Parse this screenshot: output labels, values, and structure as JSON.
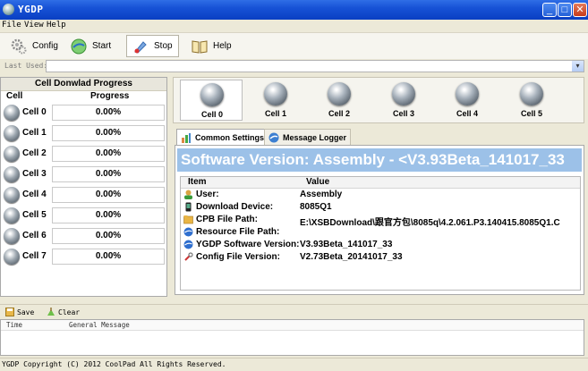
{
  "window": {
    "title": "YGDP"
  },
  "menu": [
    "File",
    "View",
    "Help"
  ],
  "toolbar": {
    "config": "Config",
    "start": "Start",
    "stop": "Stop",
    "help": "Help"
  },
  "last_used": {
    "label": "Last Used:",
    "value": ""
  },
  "progress_panel": {
    "title": "Cell Donwlad Progress",
    "col_cell": "Cell",
    "col_progress": "Progress",
    "rows": [
      {
        "cell": "Cell 0",
        "progress": "0.00%"
      },
      {
        "cell": "Cell 1",
        "progress": "0.00%"
      },
      {
        "cell": "Cell 2",
        "progress": "0.00%"
      },
      {
        "cell": "Cell 3",
        "progress": "0.00%"
      },
      {
        "cell": "Cell 4",
        "progress": "0.00%"
      },
      {
        "cell": "Cell 5",
        "progress": "0.00%"
      },
      {
        "cell": "Cell 6",
        "progress": "0.00%"
      },
      {
        "cell": "Cell 7",
        "progress": "0.00%"
      }
    ]
  },
  "cell_tabs": [
    "Cell 0",
    "Cell 1",
    "Cell 2",
    "Cell 3",
    "Cell 4",
    "Cell 5"
  ],
  "tabs": {
    "common": "Common Settings",
    "logger": "Message Logger"
  },
  "info": {
    "version_banner": "Software Version:  Assembly - <V3.93Beta_141017_33",
    "col_item": "Item",
    "col_value": "Value",
    "rows": [
      {
        "item": "User:",
        "value": "Assembly",
        "icon": "user-icon"
      },
      {
        "item": "Download Device:",
        "value": "8085Q1",
        "icon": "phone-icon"
      },
      {
        "item": "CPB File Path:",
        "value": "E:\\XSBDownload\\跟官方包\\8085q\\4.2.061.P3.140415.8085Q1.C",
        "icon": "folder-icon"
      },
      {
        "item": "Resource File Path:",
        "value": "",
        "icon": "globe-icon"
      },
      {
        "item": "YGDP Software Version:",
        "value": "V3.93Beta_141017_33",
        "icon": "globe-icon"
      },
      {
        "item": "Config File Version:",
        "value": "V2.73Beta_20141017_33",
        "icon": "tool-icon"
      }
    ]
  },
  "log": {
    "save": "Save",
    "clear": "Clear",
    "col_time": "Time",
    "col_msg": "General Message"
  },
  "status": {
    "text": "YGDP Copyright (C) 2012 CoolPad All Rights Reserved."
  }
}
